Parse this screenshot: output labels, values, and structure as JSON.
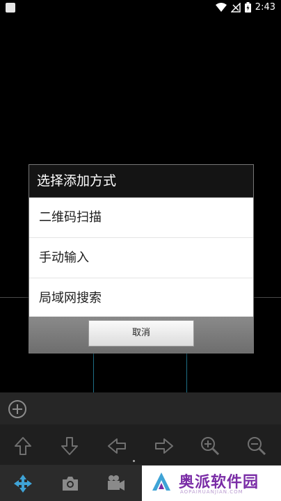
{
  "status_bar": {
    "time": "2:43"
  },
  "dialog": {
    "title": "选择添加方式",
    "options": [
      "二维码扫描",
      "手动输入",
      "局域网搜索"
    ],
    "cancel_label": "取消"
  },
  "watermark": {
    "text": "奥派软件园",
    "url": "AOPAIRUANJIAN.COM"
  },
  "colors": {
    "accent_blue": "#3fa3d6",
    "brand_purple": "#7a2ca6"
  }
}
